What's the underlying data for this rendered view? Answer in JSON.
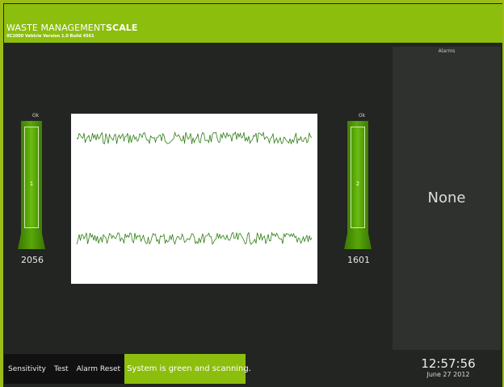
{
  "colors": {
    "accent": "#8cbe0e",
    "background": "#222521",
    "panel": "#2f312e",
    "trace": "#2e7d12"
  },
  "header": {
    "title_light": "WASTE MANAGEMENT",
    "title_bold": "SCALE",
    "subtitle": "XC2000 Vehicle Version 1.0 Build 4561"
  },
  "sensors": [
    {
      "status": "Ok",
      "index": "1",
      "value": "2056",
      "level": 1.0
    },
    {
      "status": "Ok",
      "index": "2",
      "value": "1601",
      "level": 1.0
    }
  ],
  "graph": {
    "series": [
      {
        "baseline": 0.12,
        "amplitude": 0.035
      },
      {
        "baseline": 0.71,
        "amplitude": 0.035
      }
    ]
  },
  "alarms": {
    "title": "Alarms",
    "value": "None"
  },
  "toolbar": {
    "sensitivity": "Sensitivity",
    "test": "Test",
    "alarm_reset": "Alarm Reset",
    "status_message": "System is green and scanning."
  },
  "clock": {
    "time": "12:57:56",
    "date": "June 27 2012"
  }
}
